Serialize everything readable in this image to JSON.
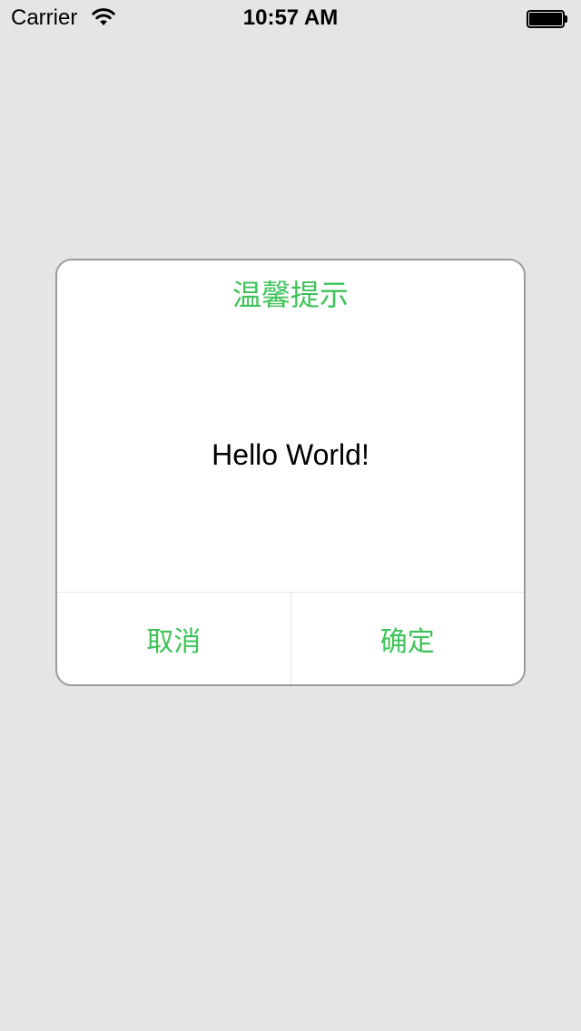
{
  "status_bar": {
    "carrier": "Carrier",
    "time": "10:57 AM"
  },
  "dialog": {
    "title": "温馨提示",
    "message": "Hello World!",
    "cancel_label": "取消",
    "confirm_label": "确定"
  },
  "colors": {
    "background": "#e5e5e5",
    "accent_green": "#3fc25a",
    "dialog_border": "#9b9b9b"
  },
  "icons": [
    "wifi-icon",
    "battery-icon"
  ]
}
